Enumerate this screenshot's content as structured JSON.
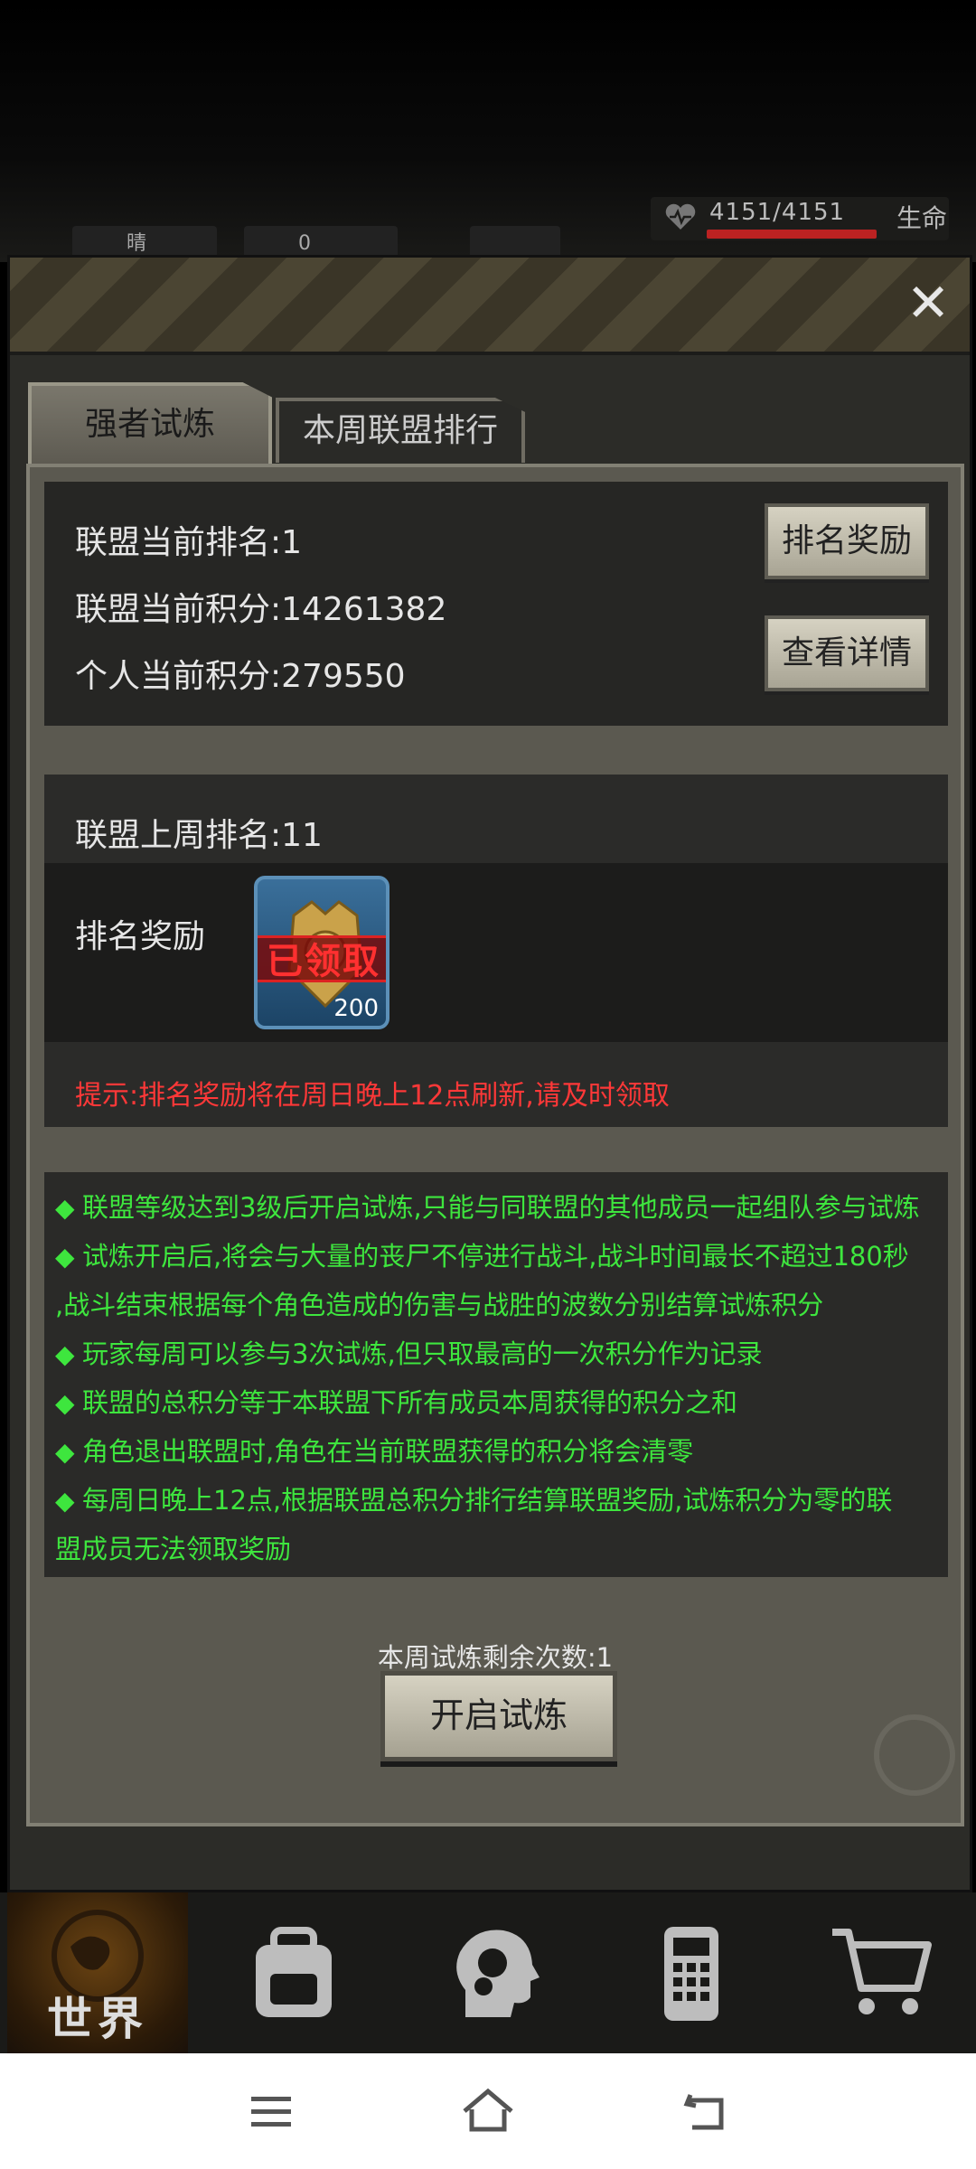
{
  "status": {
    "weather": "晴",
    "radiation": "0",
    "hp": "4151/4151",
    "hp_label": "生命"
  },
  "tabs": [
    {
      "label": "强者试炼"
    },
    {
      "label": "本周联盟排行"
    }
  ],
  "current": {
    "rank": "联盟当前排名:1",
    "alliance_score": "联盟当前积分:14261382",
    "personal_score": "个人当前积分:279550",
    "reward_button": "排名奖励",
    "detail_button": "查看详情"
  },
  "last_week": {
    "rank": "联盟上周排名:11",
    "reward_label": "排名奖励",
    "stamp": "已领取",
    "quantity": "200",
    "tip": "提示:排名奖励将在周日晚上12点刷新,请及时领取"
  },
  "rules": [
    "联盟等级达到3级后开启试炼,只能与同联盟的其他成员一起组队参与试炼",
    "试炼开启后,将会与大量的丧尸不停进行战斗,战斗时间最长不超过180秒",
    ",战斗结束根据每个角色造成的伤害与战胜的波数分别结算试炼积分",
    "玩家每周可以参与3次试炼,但只取最高的一次积分作为记录",
    "联盟的总积分等于本联盟下所有成员本周获得的积分之和",
    "角色退出联盟时,角色在当前联盟获得的积分将会清零",
    "每周日晚上12点,根据联盟总积分排行结算联盟奖励,试炼积分为零的联",
    "盟成员无法领取奖励"
  ],
  "remaining": "本周试炼剩余次数:1",
  "start_button": "开启试炼",
  "nav": {
    "world": "世界"
  },
  "colors": {
    "rules_text": "#3ee63e",
    "tip_text": "#ff3838"
  }
}
